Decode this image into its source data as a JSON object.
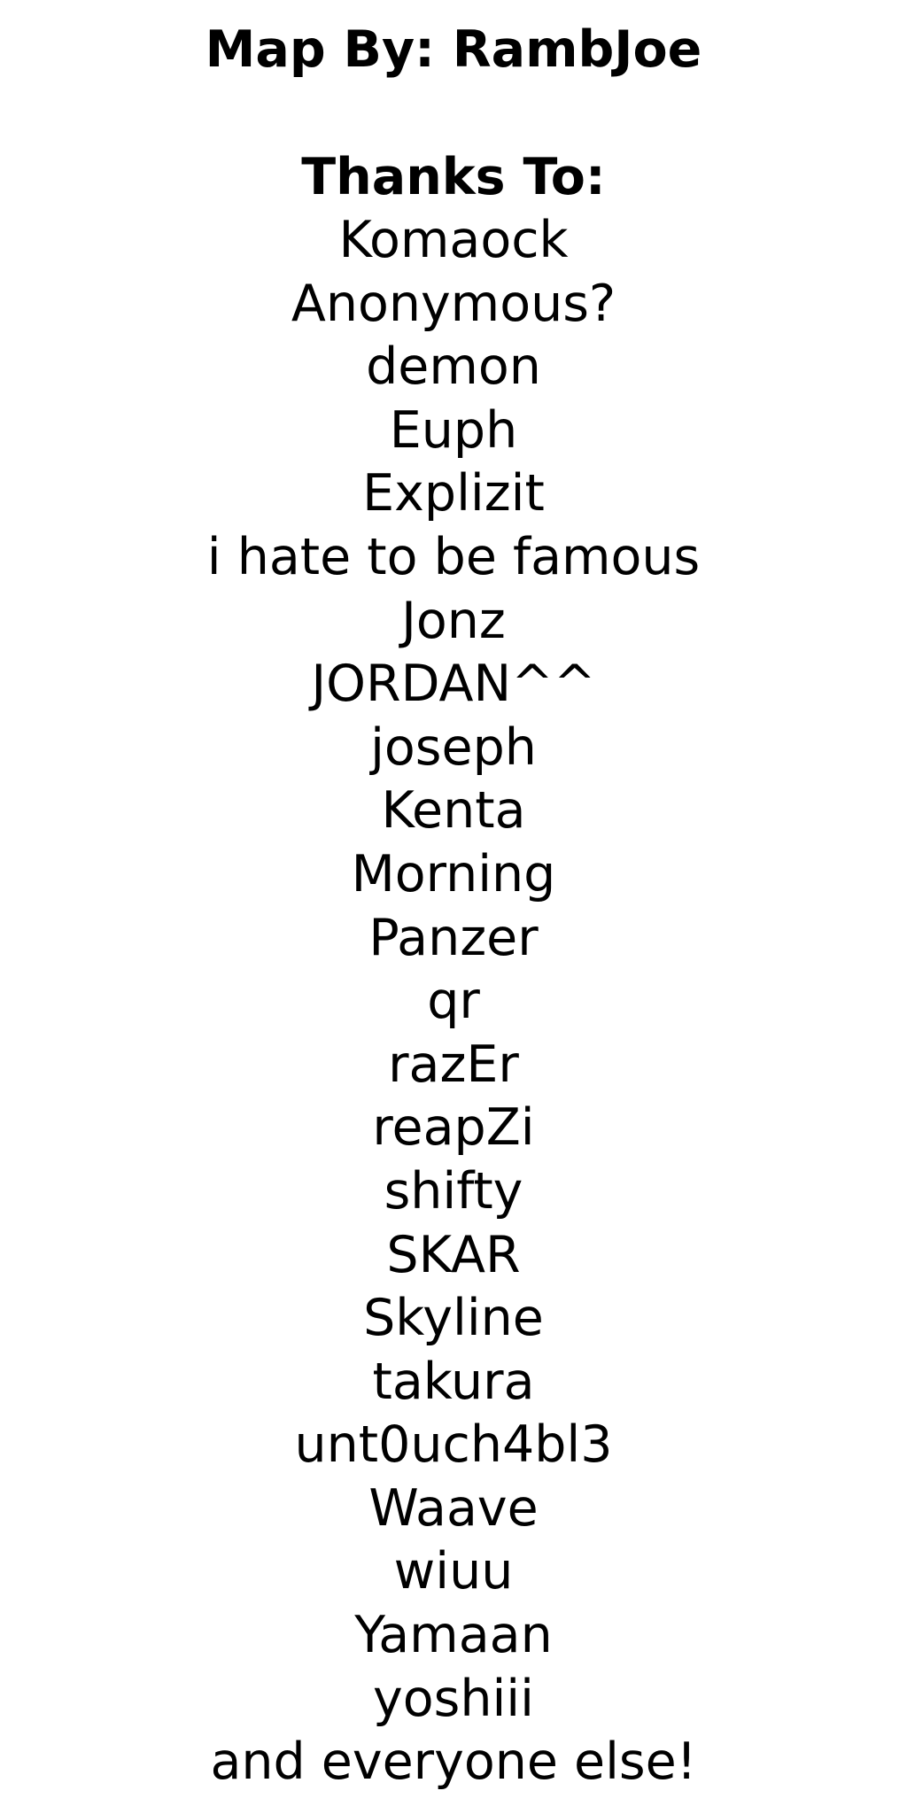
{
  "credits": {
    "map_by": "Map By: RambJoe",
    "thanks_heading": "Thanks To:",
    "names": [
      "Komaock",
      "Anonymous?",
      "demon",
      "Euph",
      "Explizit",
      "i hate to be famous",
      "Jonz",
      "JORDAN^^",
      "joseph",
      "Kenta",
      "Morning",
      "Panzer",
      "qr",
      "razEr",
      "reapZi",
      "shifty",
      "SKAR",
      "Skyline",
      "takura",
      "unt0uch4bl3",
      "Waave",
      "wiuu",
      "Yamaan",
      "yoshiii",
      "and everyone else!"
    ]
  }
}
